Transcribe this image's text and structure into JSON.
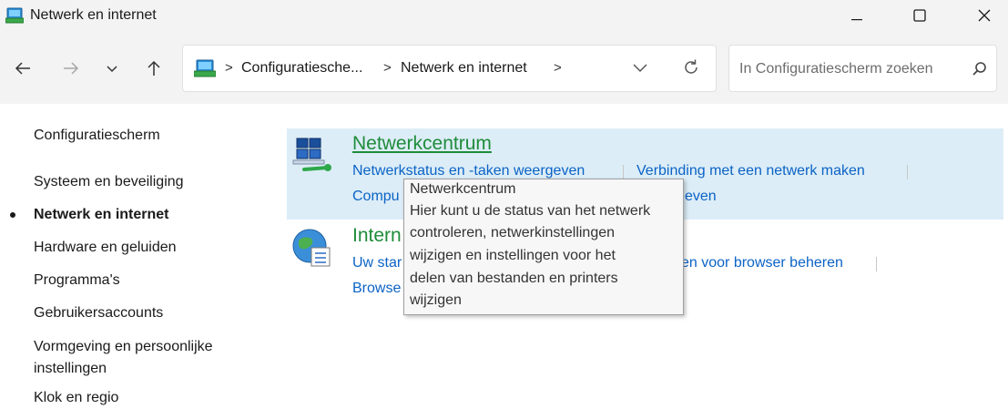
{
  "window": {
    "title": "Netwerk en internet",
    "minimize_icon": "minimize-icon",
    "maximize_icon": "maximize-icon",
    "close_icon": "close-icon"
  },
  "nav": {
    "back_icon": "arrow-left-icon",
    "forward_icon": "arrow-right-icon",
    "recent_icon": "chevron-down-icon",
    "up_icon": "arrow-up-icon"
  },
  "address": {
    "crumbs": [
      "Configuratiesche...",
      "Netwerk en internet"
    ],
    "separator": ">",
    "dropdown_icon": "chevron-down-icon",
    "refresh_icon": "refresh-icon"
  },
  "search": {
    "placeholder": "In Configuratiescherm zoeken",
    "icon": "search-icon"
  },
  "sidebar": {
    "home": "Configuratiescherm",
    "items": [
      {
        "label": "Systeem en beveiliging",
        "active": false
      },
      {
        "label": "Netwerk en internet",
        "active": true
      },
      {
        "label": "Hardware en geluiden",
        "active": false
      },
      {
        "label": "Programma's",
        "active": false
      },
      {
        "label": "Gebruikersaccounts",
        "active": false
      },
      {
        "label": "Vormgeving en persoonlijke",
        "active": false
      },
      {
        "label": "instellingen",
        "active": false
      },
      {
        "label": "Klok en regio",
        "active": false
      }
    ]
  },
  "categories": [
    {
      "title": "Netwerkcentrum",
      "icon": "network-center-icon",
      "links": [
        "Netwerkstatus en -taken weergeven",
        "Verbinding met een netwerk maken",
        "Compu",
        "even"
      ]
    },
    {
      "title": "Intern",
      "icon": "internet-options-icon",
      "links": [
        "Uw star",
        "en voor browser beheren",
        "Browse"
      ]
    }
  ],
  "tooltip": {
    "lines": [
      "Netwerkcentrum",
      "Hier kunt u de status van het netwerk",
      "controleren, netwerkinstellingen",
      "wijzigen en instellingen voor het",
      "delen van bestanden en printers",
      "wijzigen"
    ]
  },
  "colors": {
    "chrome": "#f3f3f3",
    "highlight": "#dcedf7",
    "title_green": "#1e8c3a",
    "link_blue": "#0b63c6"
  }
}
